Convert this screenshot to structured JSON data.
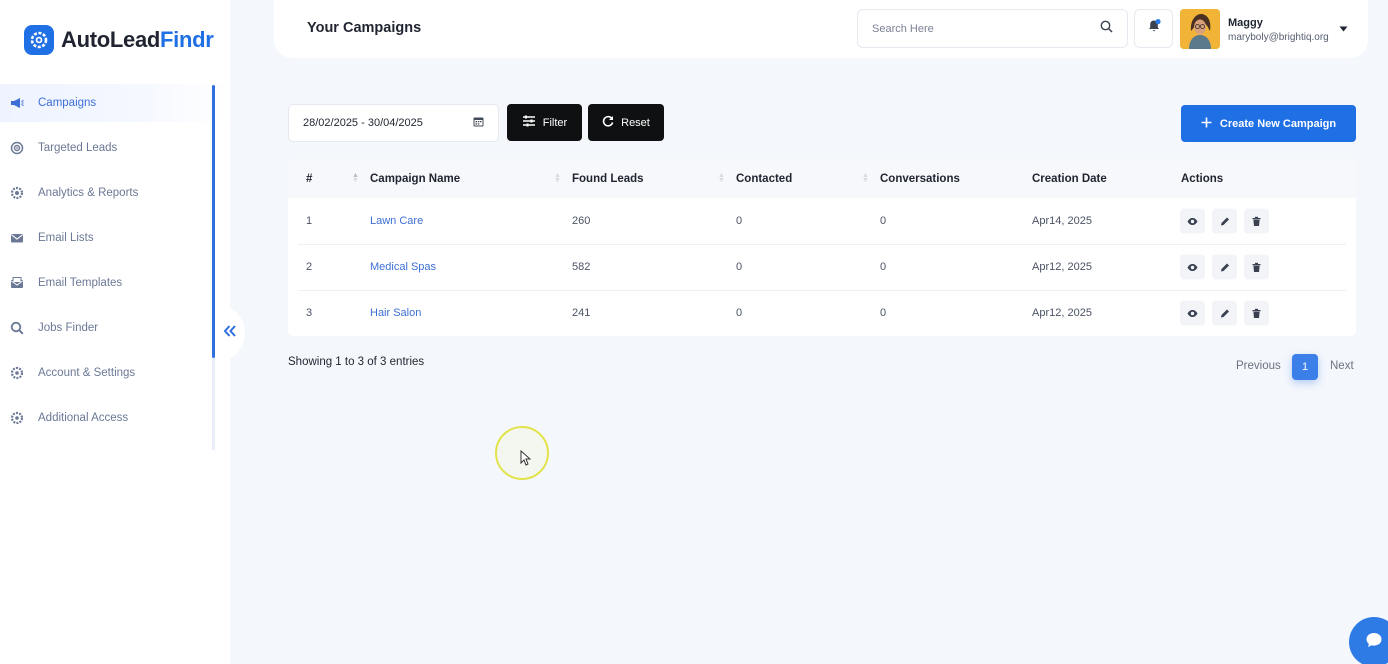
{
  "brand": {
    "name_part1": "AutoLead",
    "name_part2": "Findr",
    "accent_color": "#1f6fe5"
  },
  "sidebar": {
    "items": [
      {
        "label": "Campaigns",
        "icon": "megaphone-icon",
        "active": true
      },
      {
        "label": "Targeted Leads",
        "icon": "target-icon"
      },
      {
        "label": "Analytics & Reports",
        "icon": "analytics-gear-icon"
      },
      {
        "label": "Email Lists",
        "icon": "envelope-icon"
      },
      {
        "label": "Email Templates",
        "icon": "envelope-template-icon"
      },
      {
        "label": "Jobs Finder",
        "icon": "search-magnifier-icon"
      },
      {
        "label": "Account & Settings",
        "icon": "settings-gear-icon"
      },
      {
        "label": "Additional Access",
        "icon": "access-gear-icon"
      }
    ],
    "collapse_icon": "double-chevron-left-icon"
  },
  "header": {
    "title": "Your Campaigns",
    "search_placeholder": "Search Here",
    "user_name": "Maggy",
    "user_email": "maryboly@brightiq.org"
  },
  "toolbar": {
    "date_range": "28/02/2025 - 30/04/2025",
    "filter_label": "Filter",
    "reset_label": "Reset",
    "create_label": "Create New Campaign"
  },
  "table": {
    "columns": [
      "#",
      "Campaign Name",
      "Found Leads",
      "Contacted",
      "Conversations",
      "Creation Date",
      "Actions"
    ],
    "rows": [
      {
        "num": "1",
        "name": "Lawn Care",
        "found": "260",
        "contacted": "0",
        "conversations": "0",
        "date": "Apr14, 2025"
      },
      {
        "num": "2",
        "name": "Medical Spas",
        "found": "582",
        "contacted": "0",
        "conversations": "0",
        "date": "Apr12, 2025"
      },
      {
        "num": "3",
        "name": "Hair Salon",
        "found": "241",
        "contacted": "0",
        "conversations": "0",
        "date": "Apr12, 2025"
      }
    ]
  },
  "pagination": {
    "info": "Showing 1 to 3 of 3 entries",
    "previous": "Previous",
    "current_page": "1",
    "next": "Next"
  }
}
